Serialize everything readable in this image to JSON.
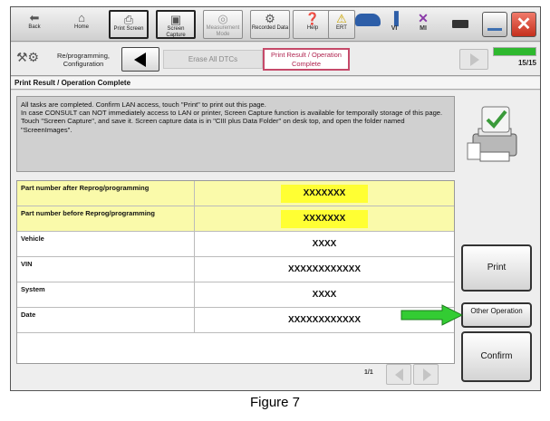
{
  "toolbar": {
    "back": "Back",
    "home": "Home",
    "print_screen": "Print Screen",
    "screen_capture": "Screen Capture",
    "measurement_mode": "Measurement Mode",
    "recorded_data": "Recorded Data",
    "help": "Help",
    "ert": "ERT",
    "vi": "VI",
    "mi": "MI"
  },
  "nav": {
    "crumb": "Re/programming, Configuration",
    "erase_dtcs": "Erase All DTCs",
    "active": "Print Result / Operation Complete",
    "progress_fraction": 1.0,
    "progress_text": "15/15"
  },
  "page_title": "Print Result / Operation Complete",
  "message": {
    "line1": "All tasks are completed. Confirm LAN access, touch \"Print\" to print out this page.",
    "line2": "In case CONSULT can NOT immediately access to LAN or printer, Screen Capture function is available for temporally storage of this page. Touch \"Screen Capture\", and save it. Screen capture data is in \"CIII plus Data Folder\" on desk top, and open the folder named \"ScreenImages\"."
  },
  "table": {
    "rows": [
      {
        "label": "Part number after Reprog/programming",
        "value": "XXXXXXX"
      },
      {
        "label": "Part number before Reprog/programming",
        "value": "XXXXXXX"
      },
      {
        "label": "Vehicle",
        "value": "XXXX"
      },
      {
        "label": "VIN",
        "value": "XXXXXXXXXXXX"
      },
      {
        "label": "System",
        "value": "XXXX"
      },
      {
        "label": "Date",
        "value": "XXXXXXXXXXXX"
      }
    ],
    "pager": "1/1"
  },
  "buttons": {
    "print": "Print",
    "other_operation": "Other Operation",
    "confirm": "Confirm"
  },
  "caption": "Figure 7",
  "colors": {
    "highlight_yellow": "#ffff33",
    "arrow_green": "#33cc33",
    "active_crumb": "#c64a6a",
    "close_red": "#d23a26"
  }
}
